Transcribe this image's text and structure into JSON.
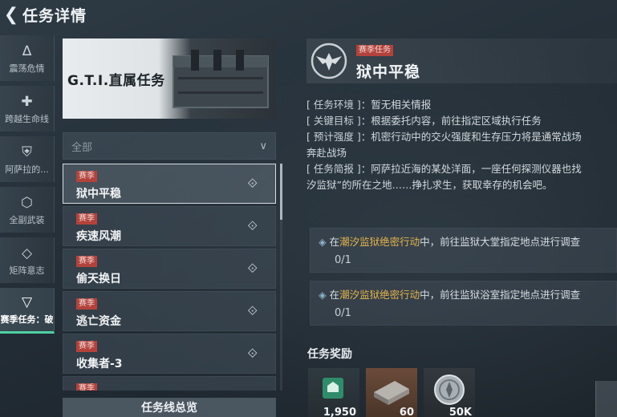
{
  "header": {
    "title": "任务详情",
    "back_icon": "back-arrow-icon"
  },
  "left_nav": [
    {
      "label": "震荡危情",
      "icon": "A-glyph-icon",
      "active": false
    },
    {
      "label": "跨越生命线",
      "icon": "plus-icon",
      "active": false
    },
    {
      "label": "阿萨拉的...",
      "icon": "shield-icon",
      "active": false
    },
    {
      "label": "全副武装",
      "icon": "hex-icon",
      "active": false
    },
    {
      "label": "矩阵意志",
      "icon": "diamond-icon",
      "active": false
    },
    {
      "label": "赛季任务：破",
      "icon": "triangle-down-icon",
      "active": true
    }
  ],
  "banner": {
    "title": "G.T.I.直属任务"
  },
  "filter": {
    "value": "全部"
  },
  "missions": [
    {
      "tag": "赛季",
      "name": "狱中平稳",
      "selected": true
    },
    {
      "tag": "赛季",
      "name": "疾速风潮",
      "selected": false
    },
    {
      "tag": "赛季",
      "name": "偷天换日",
      "selected": false
    },
    {
      "tag": "赛季",
      "name": "逃亡资金",
      "selected": false
    },
    {
      "tag": "赛季",
      "name": "收集者-3",
      "selected": false
    },
    {
      "tag": "赛季",
      "name": "",
      "selected": false
    }
  ],
  "overview_button": "任务线总览",
  "detail": {
    "tag": "赛季任务",
    "title": "狱中平稳",
    "info": [
      {
        "key": "[ 任务环境 ]：",
        "value": "暂无相关情报"
      },
      {
        "key": "[ 关键目标 ]：",
        "value": "根据委托内容，前往指定区域执行任务"
      },
      {
        "key": "[ 预计强度 ]：",
        "value": "机密行动中的交火强度和生存压力将是通常战场"
      },
      {
        "key": "",
        "value": "奔赴战场"
      },
      {
        "key": "[ 任务简报 ]：",
        "value": "阿萨拉近海的某处洋面，一座任何探测仪器也找"
      },
      {
        "key": "",
        "value": "汐监狱”的所在之地……挣扎求生，获取幸存的机会吧。"
      }
    ],
    "objectives": [
      {
        "prefix": "在",
        "highlight": "潮汐监狱绝密行动",
        "suffix": "中，前往监狱大堂指定地点进行调查",
        "progress": "0/1"
      },
      {
        "prefix": "在",
        "highlight": "潮汐监狱绝密行动",
        "suffix": "中，前往监狱浴室指定地点进行调查",
        "progress": "0/1"
      }
    ],
    "rewards_title": "任务奖励",
    "rewards": [
      {
        "icon": "green-badge-icon",
        "qty": "1,950"
      },
      {
        "icon": "ammo-box-icon",
        "qty": "60"
      },
      {
        "icon": "silver-coin-icon",
        "qty": "50K"
      }
    ]
  },
  "colors": {
    "season_tag": "#b3423c",
    "highlight": "#e4b54a",
    "active_underline": "#4fd0a0"
  }
}
